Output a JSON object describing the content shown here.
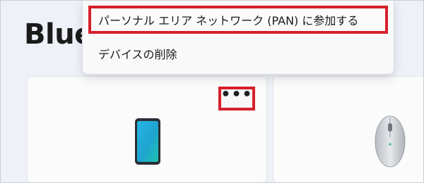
{
  "page": {
    "title": "Blue"
  },
  "context_menu": {
    "items": [
      {
        "label": "パーソナル エリア ネットワーク (PAN) に参加する",
        "highlighted": true
      },
      {
        "label": "デバイスの削除",
        "highlighted": false
      }
    ]
  },
  "device_cards": [
    {
      "icon": "phone-icon",
      "more_button": "•••"
    },
    {
      "icon": "mouse-icon"
    }
  ],
  "colors": {
    "highlight_border": "#d61f2b",
    "background": "#eef2f8",
    "card": "#fbfbfc",
    "phone_screen": "#1aa7d8"
  }
}
